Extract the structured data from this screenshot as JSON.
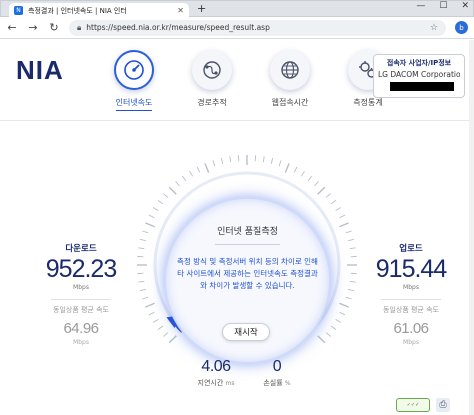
{
  "browser": {
    "tab_title": "측정결과 | 인터넷속도 | NIA 인터",
    "tab_close": "✕",
    "new_tab": "+",
    "window_buttons": [
      "—",
      "☐",
      "✕"
    ],
    "url": "https://speed.nia.or.kr/measure/speed_result.asp",
    "nav": {
      "back": "←",
      "forward": "→",
      "reload": "↻"
    }
  },
  "site": {
    "logo": "NIA",
    "menu": [
      {
        "label": "인터넷속도",
        "icon": "speedometer-icon",
        "glyph": "◔",
        "active": true
      },
      {
        "label": "경로추적",
        "icon": "route-icon",
        "glyph": "⊙",
        "active": false
      },
      {
        "label": "웹접속시간",
        "icon": "web-icon",
        "glyph": "◎",
        "active": false
      },
      {
        "label": "측정통계",
        "icon": "stats-icon",
        "glyph": "⚙",
        "active": false
      }
    ],
    "info": {
      "title": "접속자 사업자/IP정보",
      "isp": "LG DACOM Corporatio..."
    }
  },
  "panel": {
    "title": "인터넷 품질측정",
    "message": "측정 방식 및 측정서버 위치 등의 차이로 인해 타 사이트에서 제공하는 인터넷속도 측정결과와 차이가 발생할 수 있습니다.",
    "retest_label": "재시작"
  },
  "download": {
    "label": "다운로드",
    "value": "952.23",
    "unit": "Mbps",
    "avg_label": "동일상품 평균 속도",
    "avg_value": "64.96",
    "avg_unit": "Mbps"
  },
  "upload": {
    "label": "업로드",
    "value": "915.44",
    "unit": "Mbps",
    "avg_label": "동일상품 평균 속도",
    "avg_value": "61.06",
    "avg_unit": "Mbps"
  },
  "latency": {
    "value": "4.06",
    "label": "지연시간",
    "unit": "ms"
  },
  "loss": {
    "value": "0",
    "label": "손실률",
    "unit": "%"
  },
  "gauge": {
    "progress_fraction": 0.02,
    "accent_color": "#1f4fd8"
  },
  "colors": {
    "brand": "#1a2a6c",
    "accent": "#1f4fd8"
  }
}
